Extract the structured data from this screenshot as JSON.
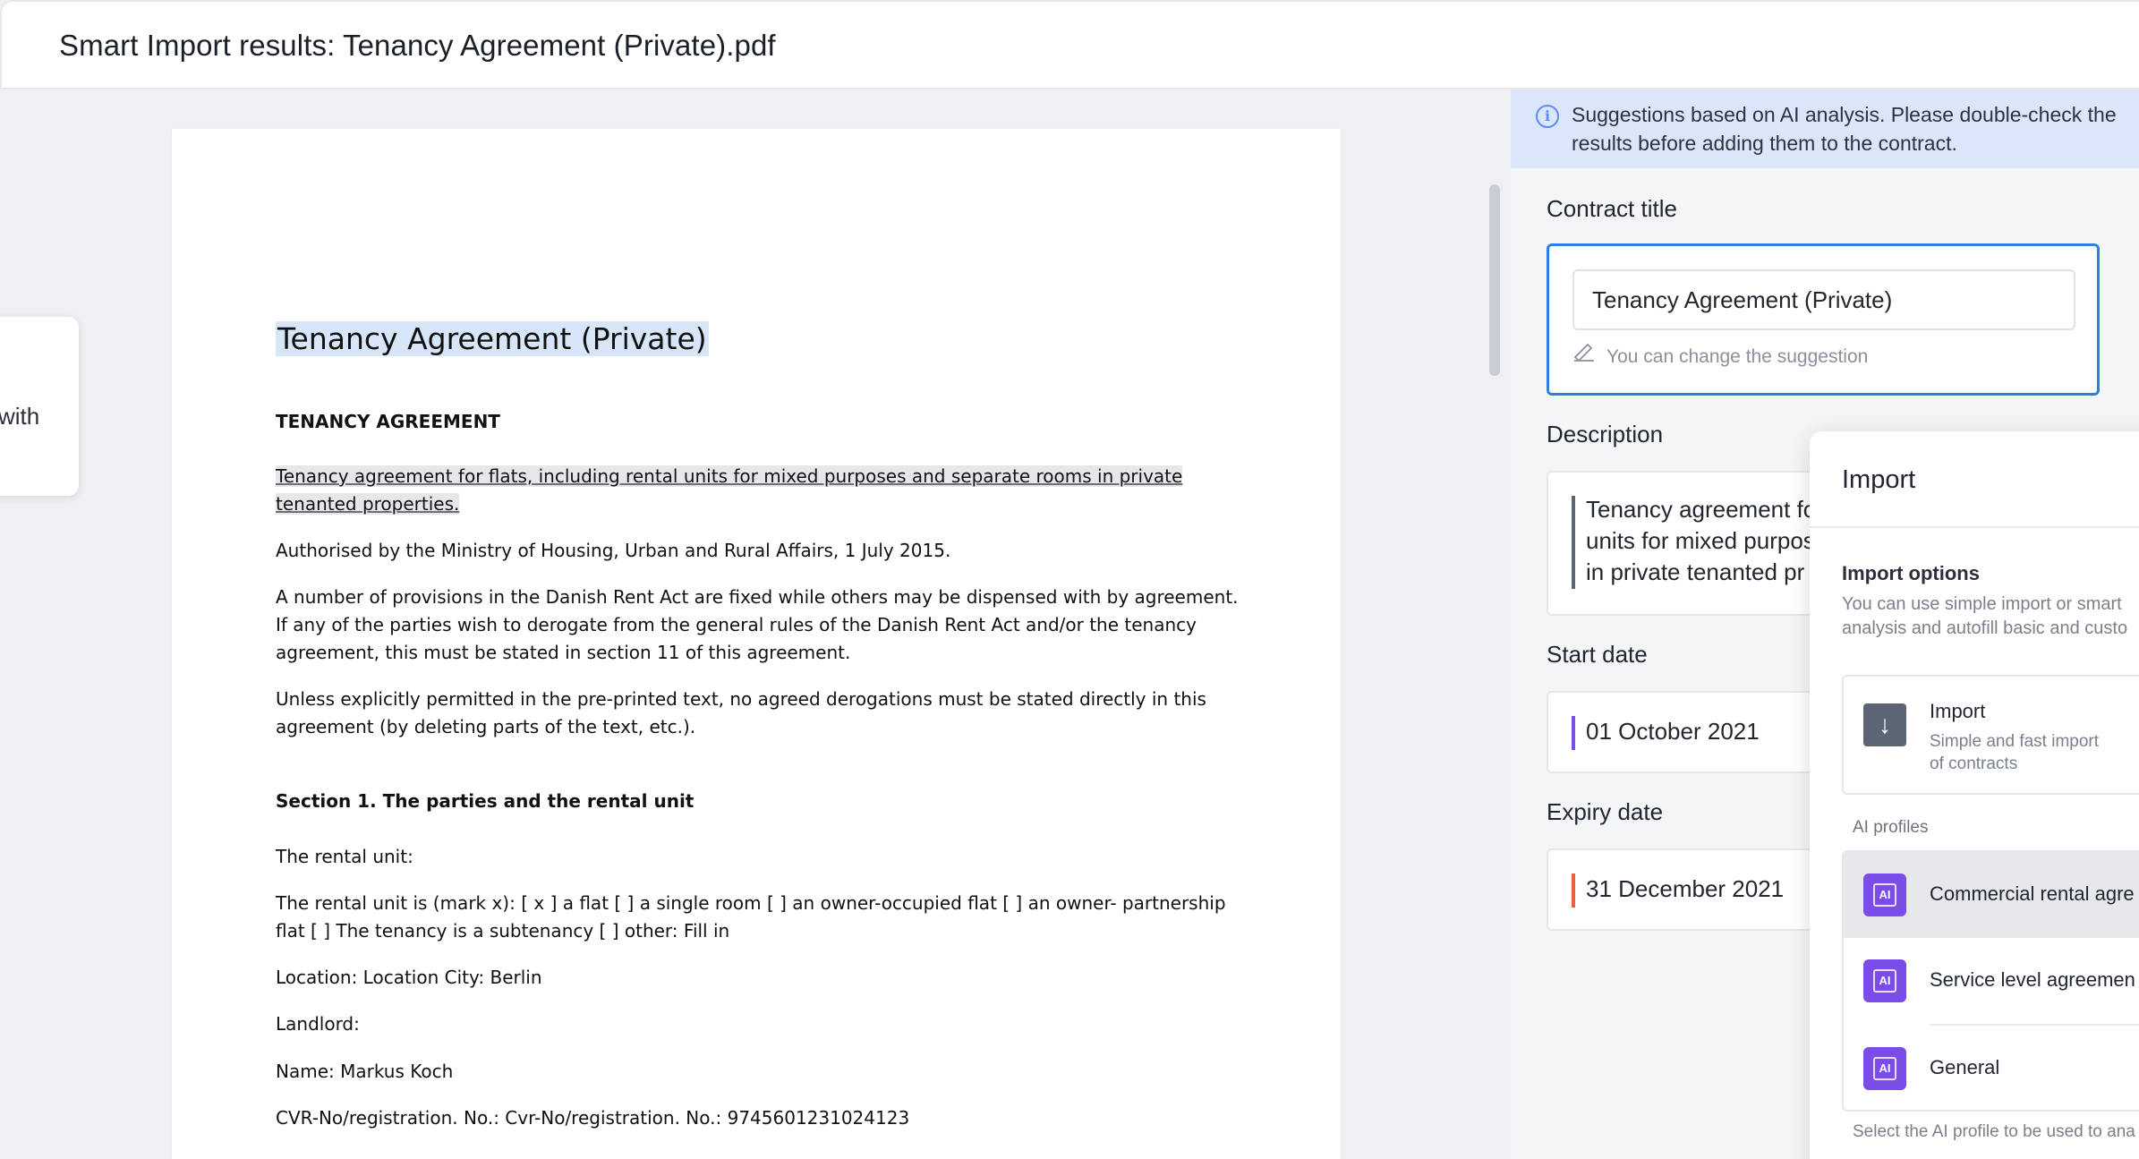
{
  "header": {
    "title": "Smart Import results: Tenancy Agreement (Private).pdf"
  },
  "side_card": {
    "text": "with"
  },
  "document": {
    "title": "Tenancy Agreement (Private)",
    "heading": "TENANCY AGREEMENT",
    "intro_line1": "Tenancy agreement for flats, including rental units for mixed purposes and separate rooms in private",
    "intro_line2": "tenanted properties.",
    "authorised": "Authorised by the Ministry of Housing, Urban and Rural Affairs, 1 July 2015.",
    "para1_line1": "A number of provisions in the Danish Rent Act are fixed while others may be dispensed with by agreement.",
    "para1_line2": "If any of the parties wish to derogate from the general rules of the Danish Rent Act and/or the tenancy",
    "para1_line3": "agreement, this must be stated in section 11 of this agreement.",
    "para2_line1": "Unless explicitly permitted in the pre-printed text, no agreed derogations must be stated directly in this",
    "para2_line2": "agreement (by deleting parts of the text, etc.).",
    "section1": "Section 1. The parties and the rental unit",
    "rental_unit_label": "The rental unit:",
    "rental_unit_line1": "The rental unit is (mark x): [ x ] a flat [   ] a single room [   ] an owner-occupied flat [   ] an owner- partnership",
    "rental_unit_line2": "flat [   ] The tenancy is a subtenancy [   ] other: Fill in",
    "location": "Location: Location City: Berlin",
    "landlord": "Landlord:",
    "name": "Name: Markus Koch",
    "cvr": "CVR-No/registration. No.: Cvr-No/registration. No.: 9745601231024123"
  },
  "info_banner": {
    "text": "Suggestions based on AI analysis. Please double-check the results before adding them to the contract."
  },
  "contract_title": {
    "label": "Contract title",
    "value": "Tenancy Agreement (Private)",
    "hint": "You can change the suggestion"
  },
  "description": {
    "label": "Description",
    "line1": "Tenancy agreement fo",
    "line2": "units for mixed purpos",
    "line3": "in private tenanted pr"
  },
  "start_date": {
    "label": "Start date",
    "value": "01 October 2021",
    "accent": "#7b4de8"
  },
  "expiry_date": {
    "label": "Expiry date",
    "value": "31 December 2021",
    "accent": "#e8613a"
  },
  "import_panel": {
    "title": "Import",
    "options_label": "Import options",
    "options_desc_line1": "You can use simple import or smart",
    "options_desc_line2": "analysis and autofill basic and custo",
    "simple_import": {
      "title": "Import",
      "desc_line1": "Simple and fast import",
      "desc_line2": "of contracts"
    },
    "ai_profiles_label": "AI profiles",
    "ai_profiles": [
      {
        "name": "Commercial rental agre",
        "selected": true
      },
      {
        "name": "Service level agreemen",
        "selected": false
      },
      {
        "name": "General",
        "selected": false
      }
    ],
    "footer": "Select the AI profile to be used to ana"
  },
  "colors": {
    "accent_blue": "#2f7fe0",
    "ai_purple": "#7b4de8",
    "banner": "#dbe6fb"
  }
}
